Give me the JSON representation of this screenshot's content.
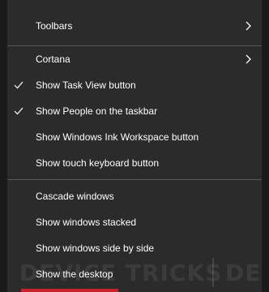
{
  "menu": {
    "items": [
      {
        "label": "Toolbars",
        "checked": false,
        "submenu": true
      },
      {
        "label": "Cortana",
        "checked": false,
        "submenu": true
      },
      {
        "label": "Show Task View button",
        "checked": true,
        "submenu": false
      },
      {
        "label": "Show People on the taskbar",
        "checked": true,
        "submenu": false
      },
      {
        "label": "Show Windows Ink Workspace button",
        "checked": false,
        "submenu": false
      },
      {
        "label": "Show touch keyboard button",
        "checked": false,
        "submenu": false
      },
      {
        "label": "Cascade windows",
        "checked": false,
        "submenu": false
      },
      {
        "label": "Show windows stacked",
        "checked": false,
        "submenu": false
      },
      {
        "label": "Show windows side by side",
        "checked": false,
        "submenu": false
      },
      {
        "label": "Show the desktop",
        "checked": false,
        "submenu": false
      }
    ]
  },
  "watermark": {
    "text": "DEVICE TRICKS",
    "text_right": "DE"
  },
  "colors": {
    "menu_bg": "#2b2b2b",
    "text": "#ffffff",
    "separator": "#5a5a5a",
    "accent_red": "#c8232c"
  }
}
